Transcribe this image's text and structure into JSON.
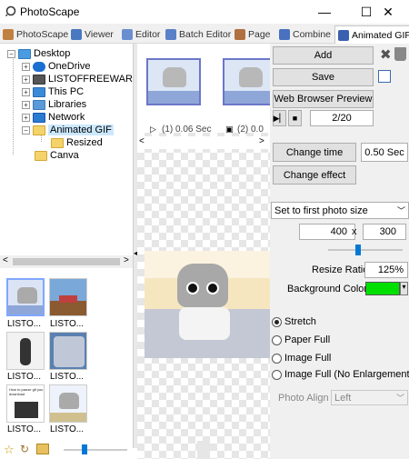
{
  "window": {
    "title": "PhotoScape",
    "minimize": "—",
    "maximize": "☐",
    "close": "✕"
  },
  "tabs": [
    {
      "label": "PhotoScape"
    },
    {
      "label": "Viewer"
    },
    {
      "label": "Editor"
    },
    {
      "label": "Batch Editor"
    },
    {
      "label": "Page"
    },
    {
      "label": "Combine"
    },
    {
      "label": "Animated GIF"
    }
  ],
  "tree": {
    "items": [
      {
        "label": "Desktop"
      },
      {
        "label": "OneDrive"
      },
      {
        "label": "LISTOFFREEWARE"
      },
      {
        "label": "This PC"
      },
      {
        "label": "Libraries"
      },
      {
        "label": "Network"
      },
      {
        "label": "Animated GIF"
      },
      {
        "label": "Resized"
      },
      {
        "label": "Canva"
      }
    ]
  },
  "thumbnails": {
    "labels": [
      "LISTO...",
      "LISTO...",
      "LISTO...",
      "LISTO...",
      "LISTO...",
      "LISTO..."
    ],
    "tiny_text": "How to pause gif you download"
  },
  "frames": {
    "frame1_label": "(1) 0.06 Sec",
    "frame2_label": "(2) 0.0"
  },
  "controls": {
    "add_label": "Add",
    "save_label": "Save",
    "web_preview_label": "Web Browser Preview",
    "frame_counter": "2/20",
    "change_time_label": "Change time",
    "time_value": "0.50 Sec",
    "change_effect_label": "Change effect",
    "size_mode": "Set to first photo size",
    "width": "400",
    "x_sep": "x",
    "height": "300",
    "resize_ratio_label": "Resize Ratio",
    "resize_ratio_value": "125%",
    "bg_color_label": "Background Color",
    "bg_color": "#00e000",
    "radio_options": [
      "Stretch",
      "Paper Full",
      "Image Full",
      "Image Full (No Enlargement)"
    ],
    "selected_radio": 0,
    "photo_align_label": "Photo Align",
    "photo_align_value": "Left",
    "slider_value": 0.5
  },
  "colors": {
    "accent": "#0078d7",
    "selection": "#cce8ff",
    "frame_border": "#6b77c8"
  }
}
